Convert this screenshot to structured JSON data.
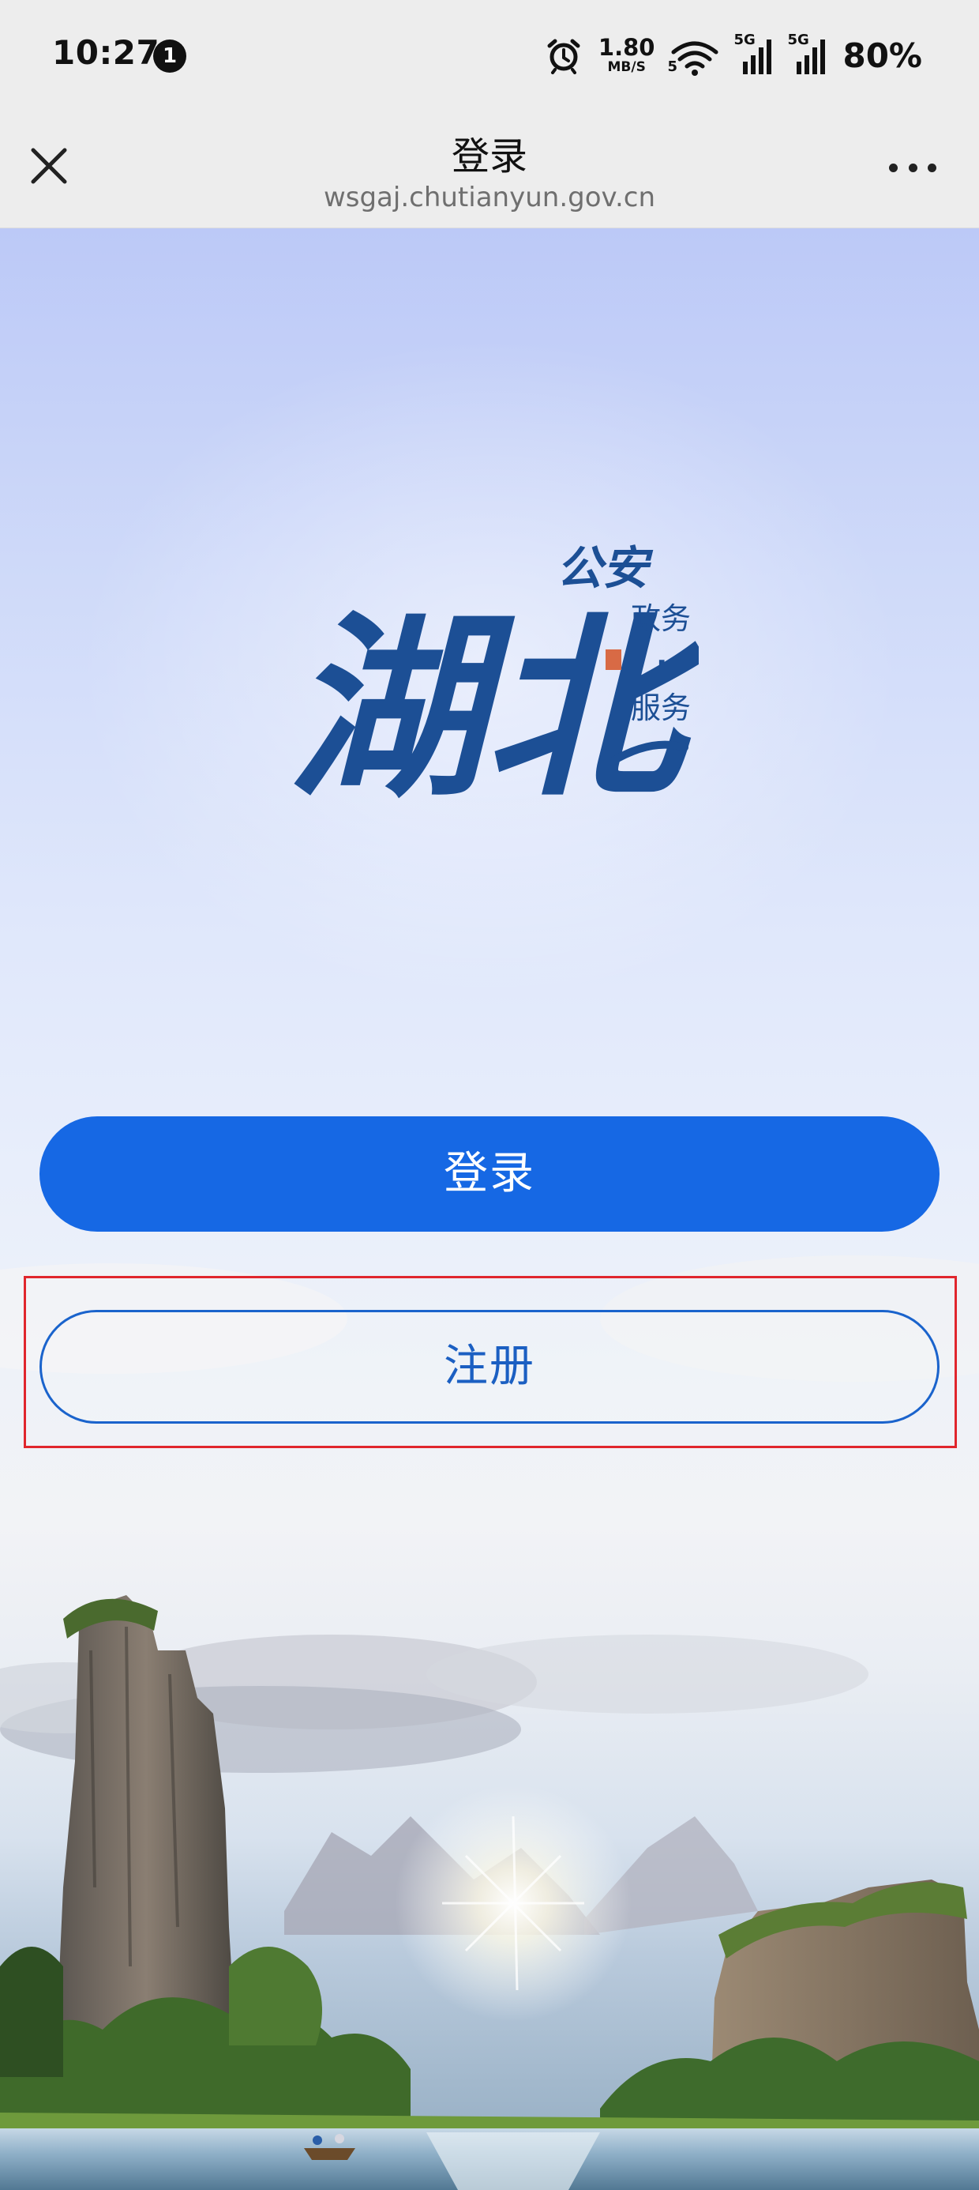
{
  "status_bar": {
    "time": "10:27",
    "notification_count": "1",
    "net_speed_value": "1.80",
    "net_speed_unit": "MB/S",
    "wifi_label": "5",
    "signal_1_label": "5G",
    "signal_2_label": "5G",
    "battery": "80%"
  },
  "nav": {
    "title": "登录",
    "url": "wsgaj.chutianyun.gov.cn",
    "close_icon": "close-icon",
    "more_icon": "more-dots-icon"
  },
  "logo": {
    "main_text": "湖北",
    "sub_text_top": "公安",
    "sub_text_1": "政务",
    "sub_text_dot": "·",
    "sub_text_2": "服务"
  },
  "buttons": {
    "login_label": "登录",
    "register_label": "注册"
  },
  "colors": {
    "primary_blue": "#1668e4",
    "register_text": "#1b5fc2",
    "logo_blue": "#1c4f95",
    "highlight_red": "#e0262d",
    "bar_background": "#ededed"
  }
}
